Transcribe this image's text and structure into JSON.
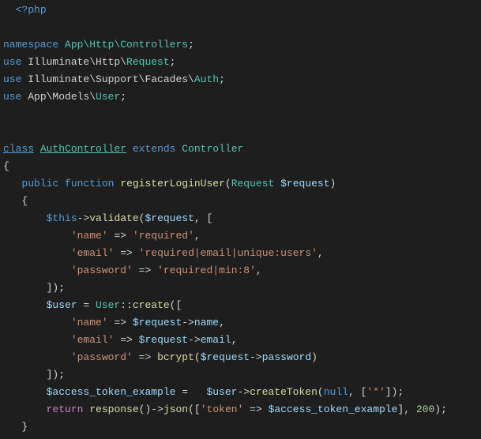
{
  "lines": {
    "php_open": "<?php",
    "namespace_kw": "namespace",
    "namespace_path": "App\\Http\\Controllers",
    "use_kw": "use",
    "use1_path": "Illuminate\\Http\\",
    "use1_class": "Request",
    "use2_path": "Illuminate\\Support\\Facades\\",
    "use2_class": "Auth",
    "use3_path": "App\\Models\\",
    "use3_class": "User",
    "class_kw": "class",
    "class_name": "AuthController",
    "extends_kw": "extends",
    "parent_class": "Controller",
    "public_kw": "public",
    "function_kw": "function",
    "method_name": "registerLoginUser",
    "param_type": "Request",
    "param_var": "$request",
    "this_var": "$this",
    "validate_method": "validate",
    "request_var": "$request",
    "name_key": "'name'",
    "name_rule": "'required'",
    "email_key": "'email'",
    "email_rule": "'required|email|unique:users'",
    "password_key": "'password'",
    "password_rule": "'required|min:8'",
    "user_var": "$user",
    "user_class": "User",
    "create_method": "create",
    "name_prop": "name",
    "email_prop": "email",
    "password_prop": "password",
    "bcrypt_fn": "bcrypt",
    "token_var": "$access_token_example",
    "createToken_method": "createToken",
    "null_kw": "null",
    "star_str": "'*'",
    "return_kw": "return",
    "response_fn": "response",
    "json_method": "json",
    "token_key": "'token'",
    "token_val_var": "$access_token_example",
    "status_code": "200",
    "arrow": "=>",
    "obj_arrow": "->",
    "scope": "::",
    "semi": ";",
    "comma": ",",
    "eq": " = ",
    "open_brace": "{",
    "close_brace": "}",
    "open_paren": "(",
    "close_paren": ")",
    "open_bracket": "[",
    "close_bracket": "]"
  }
}
